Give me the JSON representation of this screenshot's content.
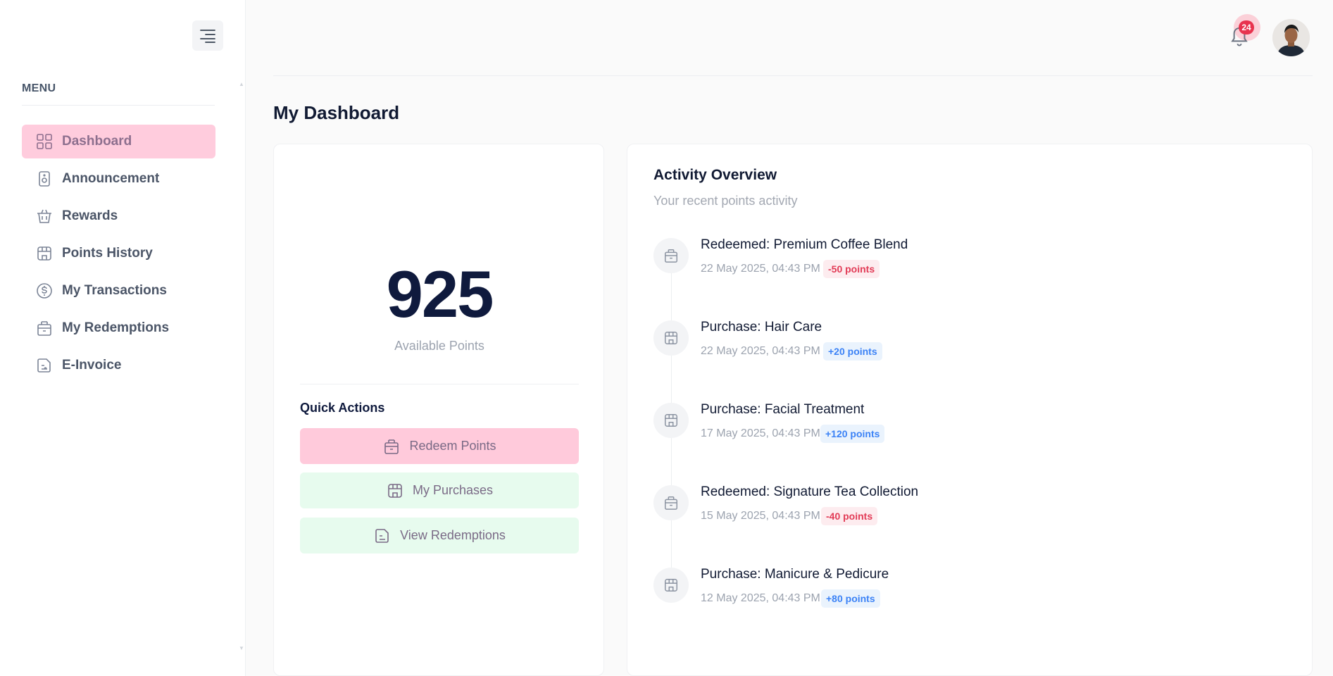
{
  "sidebar": {
    "menu_label": "MENU",
    "items": [
      {
        "label": "Dashboard",
        "icon": "dashboard-grid-icon",
        "active": true
      },
      {
        "label": "Announcement",
        "icon": "speaker-icon",
        "active": false
      },
      {
        "label": "Rewards",
        "icon": "basket-icon",
        "active": false
      },
      {
        "label": "Points History",
        "icon": "store-icon",
        "active": false
      },
      {
        "label": "My Transactions",
        "icon": "dollar-circle-icon",
        "active": false
      },
      {
        "label": "My Redemptions",
        "icon": "gift-bag-icon",
        "active": false
      },
      {
        "label": "E-Invoice",
        "icon": "invoice-icon",
        "active": false
      }
    ]
  },
  "header": {
    "notification_count": "24"
  },
  "page": {
    "title": "My Dashboard"
  },
  "points": {
    "value": "925",
    "label": "Available Points",
    "quick_actions_title": "Quick Actions",
    "actions": [
      {
        "label": "Redeem Points",
        "icon": "gift-bag-icon"
      },
      {
        "label": "My Purchases",
        "icon": "store-icon"
      },
      {
        "label": "View Redemptions",
        "icon": "invoice-icon"
      }
    ]
  },
  "activity": {
    "title": "Activity Overview",
    "subtitle": "Your recent points activity",
    "items": [
      {
        "name": "Redeemed: Premium Coffee Blend",
        "date": "22 May 2025, 04:43 PM",
        "points": "-50 points",
        "kind": "neg",
        "icon": "gift-bag-icon"
      },
      {
        "name": "Purchase: Hair Care",
        "date": "22 May 2025, 04:43 PM",
        "points": "+20 points",
        "kind": "pos",
        "icon": "store-icon"
      },
      {
        "name": "Purchase: Facial Treatment",
        "date": "17 May 2025, 04:43 PM",
        "points": "+120 points",
        "kind": "pos",
        "icon": "store-icon"
      },
      {
        "name": "Redeemed: Signature Tea Collection",
        "date": "15 May 2025, 04:43 PM",
        "points": "-40 points",
        "kind": "neg",
        "icon": "gift-bag-icon"
      },
      {
        "name": "Purchase: Manicure & Pedicure",
        "date": "12 May 2025, 04:43 PM",
        "points": "+80 points",
        "kind": "pos",
        "icon": "store-icon"
      }
    ]
  },
  "colors": {
    "accent_pink": "#ffccdd",
    "accent_green": "#e7fbee",
    "negative": "#e23b56",
    "positive": "#3b82f6"
  }
}
